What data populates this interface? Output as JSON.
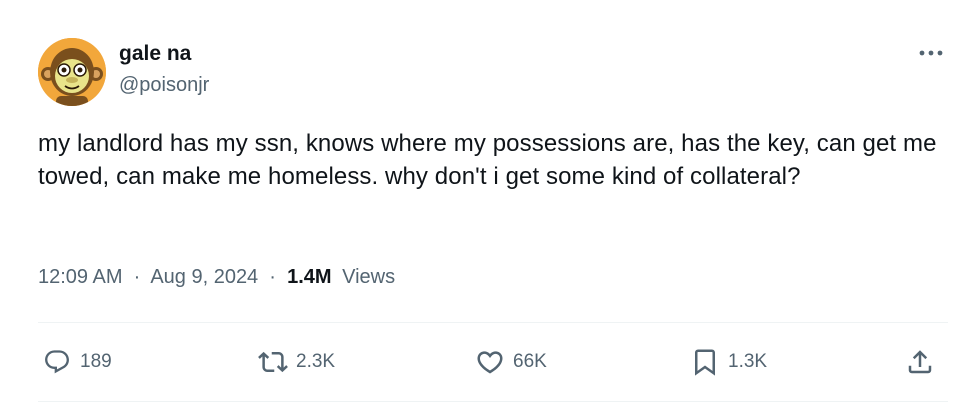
{
  "author": {
    "display_name": "gale na",
    "handle": "@poisonjr",
    "avatar_icon": "cartoon-monkey-avatar-icon"
  },
  "more_icon": "more-options-icon",
  "tweet": {
    "text": "my landlord has my ssn, knows where my possessions are, has the key, can get me towed, can make me homeless. why don't i get some kind of collateral?"
  },
  "meta": {
    "time": "12:09 AM",
    "separator": "·",
    "date": "Aug 9, 2024",
    "views_count": "1.4M",
    "views_label": "Views"
  },
  "actions": {
    "replies": {
      "icon": "reply-icon",
      "count": "189"
    },
    "reposts": {
      "icon": "repost-icon",
      "count": "2.3K"
    },
    "likes": {
      "icon": "heart-icon",
      "count": "66K"
    },
    "bookmarks": {
      "icon": "bookmark-icon",
      "count": "1.3K"
    },
    "share": {
      "icon": "share-icon"
    }
  },
  "colors": {
    "text_primary": "#0f1419",
    "text_secondary": "#536471",
    "divider": "#eff3f4",
    "avatar_bg": "#f2a73b"
  }
}
